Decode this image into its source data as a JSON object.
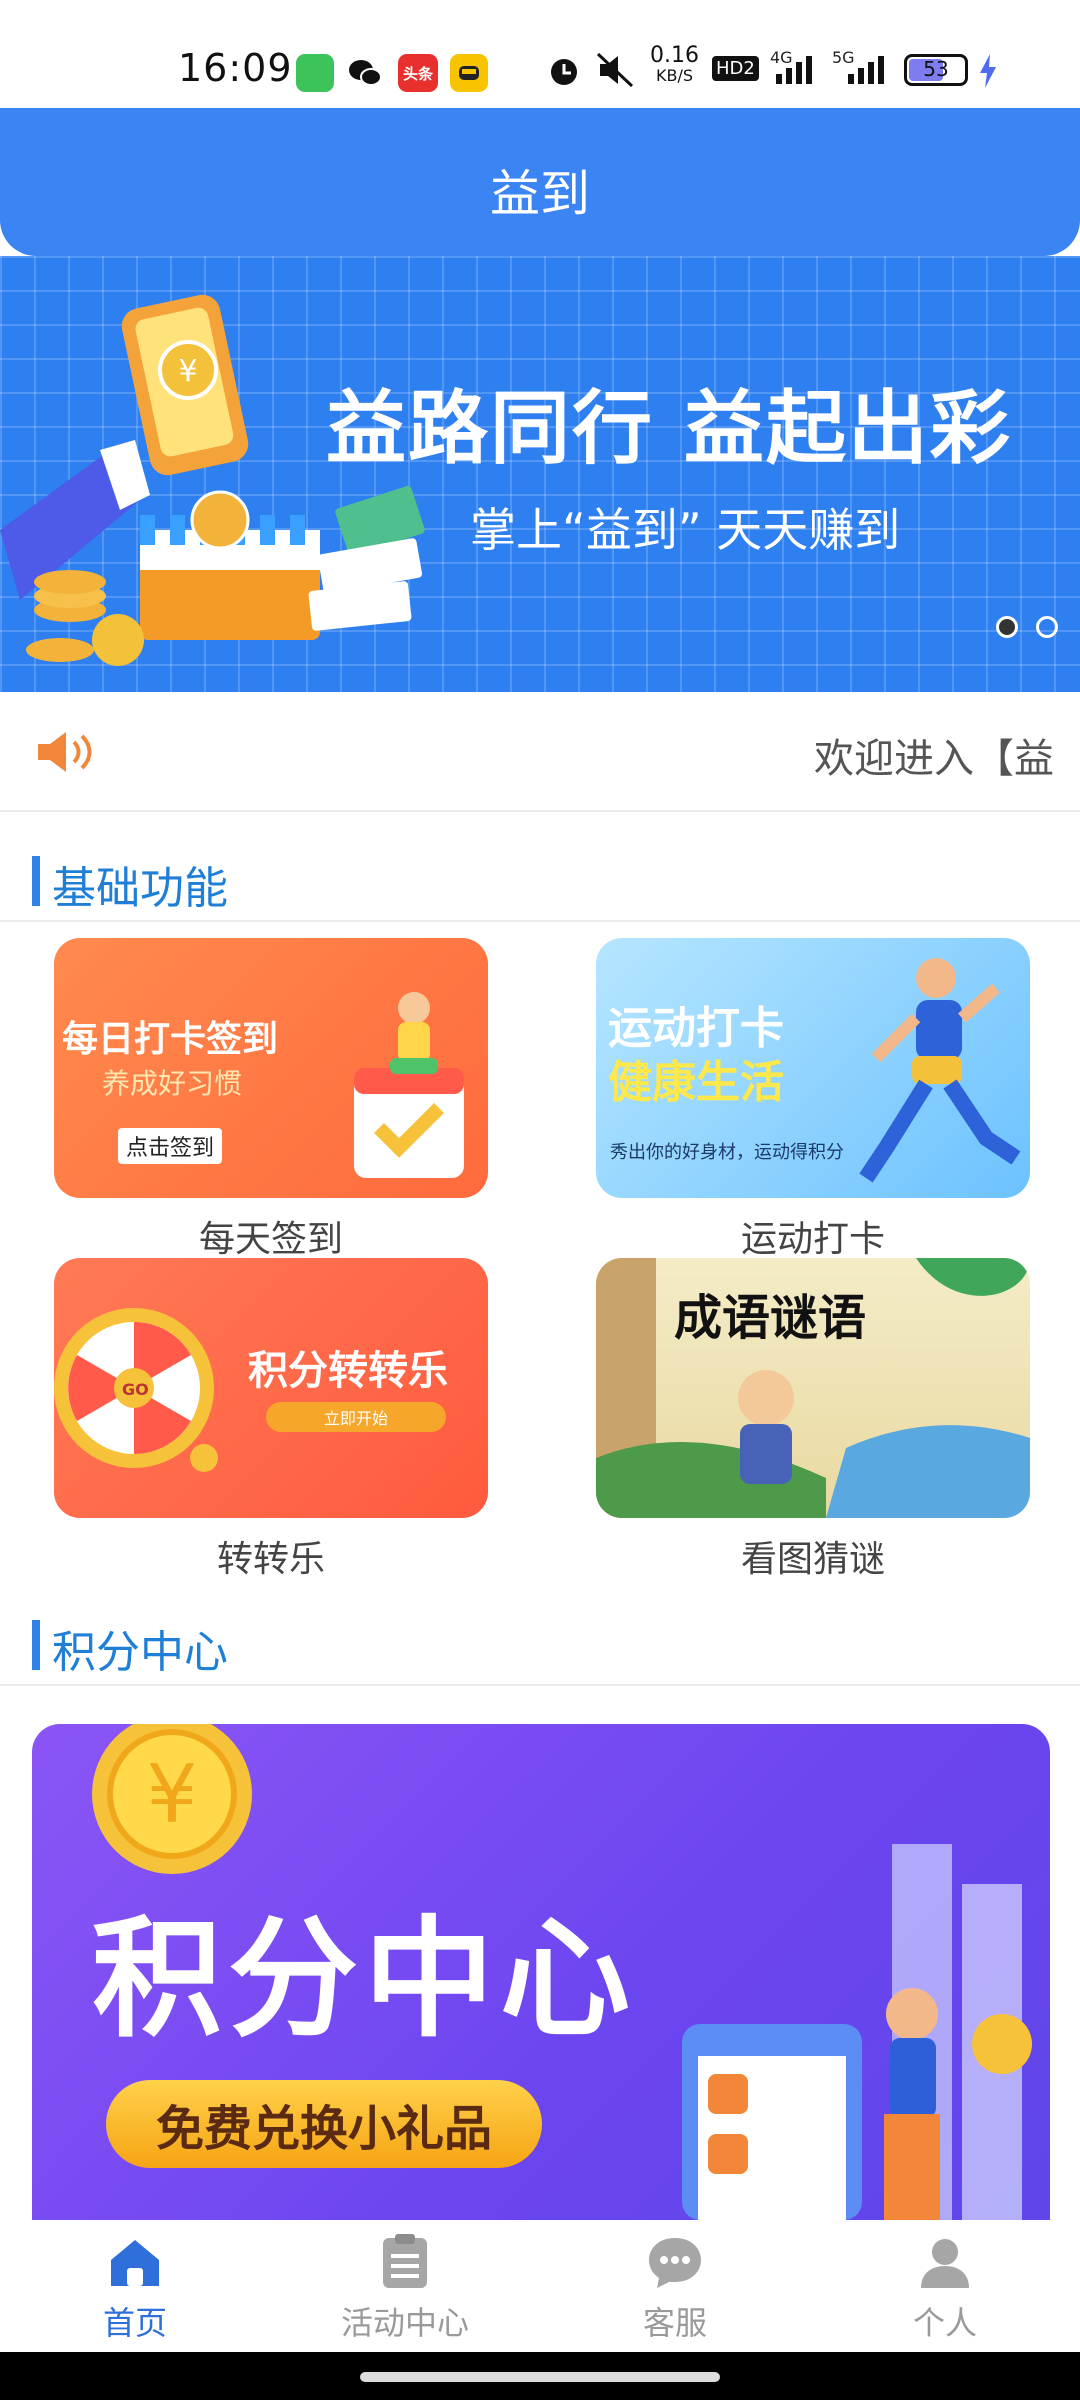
{
  "status_bar": {
    "time": "16:09",
    "net_speed_top": "0.16",
    "net_speed_bottom": "KB/S",
    "hd": "HD2",
    "sig_4g": "4G",
    "sig_5g": "5G",
    "battery": "53",
    "app_badge": "头条"
  },
  "header": {
    "title": "益到"
  },
  "banner": {
    "title": "益路同行  益起出彩",
    "subtitle": "掌上“益到” 天天赚到",
    "pages": 2,
    "active_page": 1
  },
  "notice": {
    "text": "欢迎进入【益"
  },
  "sections": {
    "basic": "基础功能",
    "points": "积分中心"
  },
  "features": [
    {
      "label": "每天签到",
      "img_title": "每日打卡签到",
      "img_sub": "养成好习惯",
      "img_button": "点击签到"
    },
    {
      "label": "运动打卡",
      "img_title": "运动打卡",
      "img_sub": "健康生活",
      "img_note": "秀出你的好身材，运动得积分"
    },
    {
      "label": "转转乐",
      "img_title": "积分转转乐",
      "img_button": "立即开始",
      "wheel_text": "GO"
    },
    {
      "label": "看图猜谜",
      "img_title": "成语谜语"
    }
  ],
  "points_banner": {
    "title": "积分中心",
    "button": "免费兑换小礼品"
  },
  "tabs": [
    {
      "label": "首页",
      "icon": "home-icon",
      "active": true
    },
    {
      "label": "活动中心",
      "icon": "clipboard-icon",
      "active": false
    },
    {
      "label": "客服",
      "icon": "chat-icon",
      "active": false
    },
    {
      "label": "个人",
      "icon": "user-icon",
      "active": false
    }
  ],
  "colors": {
    "primary": "#3a84f3",
    "section_accent": "#1f7fd6",
    "tab_active": "#2f6fd9",
    "tab_inactive": "#9a9a9a"
  }
}
